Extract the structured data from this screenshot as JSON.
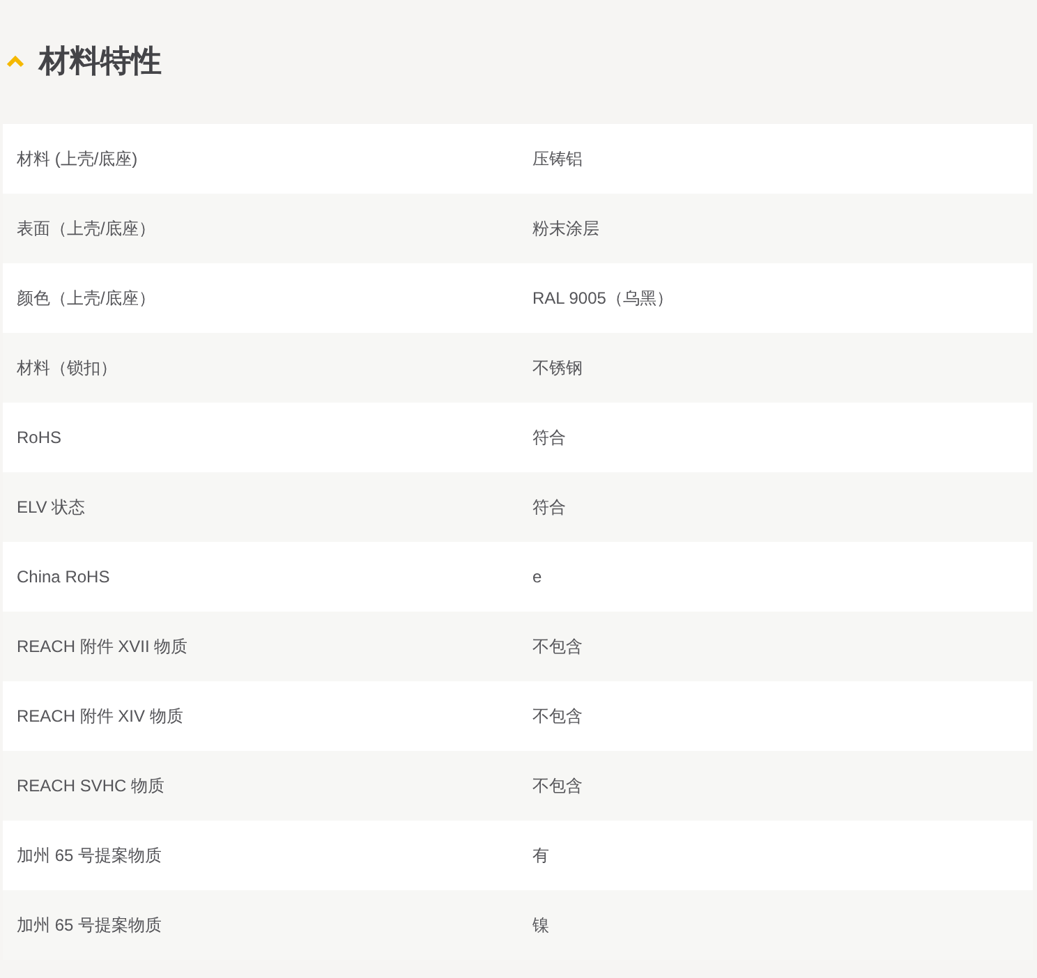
{
  "section": {
    "title": "材料特性",
    "expanded": true
  },
  "rows": [
    {
      "label": "材料 (上壳/底座)",
      "value": "压铸铝"
    },
    {
      "label": "表面（上壳/底座）",
      "value": "粉末涂层"
    },
    {
      "label": "颜色（上壳/底座）",
      "value": "RAL 9005（乌黑）"
    },
    {
      "label": "材料（锁扣）",
      "value": "不锈钢"
    },
    {
      "label": "RoHS",
      "value": "符合"
    },
    {
      "label": "ELV 状态",
      "value": "符合"
    },
    {
      "label": "China RoHS",
      "value": "e"
    },
    {
      "label": "REACH 附件 XVII 物质",
      "value": "不包含"
    },
    {
      "label": "REACH 附件 XIV 物质",
      "value": "不包含"
    },
    {
      "label": "REACH SVHC 物质",
      "value": "不包含"
    },
    {
      "label": "加州 65 号提案物质",
      "value": "有"
    },
    {
      "label": "加州 65 号提案物质",
      "value": "镍"
    }
  ]
}
